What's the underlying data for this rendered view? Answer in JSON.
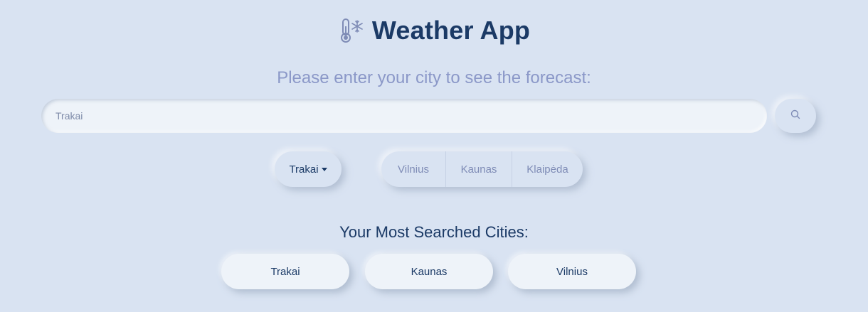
{
  "header": {
    "title": "Weather App",
    "icon": "thermometer-snowflake-icon"
  },
  "search": {
    "prompt": "Please enter your city to see the forecast:",
    "value": "Trakai",
    "button_icon": "search-icon"
  },
  "dropdown": {
    "selected": "Trakai"
  },
  "city_buttons": [
    "Vilnius",
    "Kaunas",
    "Klaipėda"
  ],
  "most_searched": {
    "title": "Your Most Searched Cities:",
    "cities": [
      "Trakai",
      "Kaunas",
      "Vilnius"
    ]
  },
  "colors": {
    "background": "#d9e3f2",
    "title": "#1b3a66",
    "accent": "#8b98c8"
  }
}
